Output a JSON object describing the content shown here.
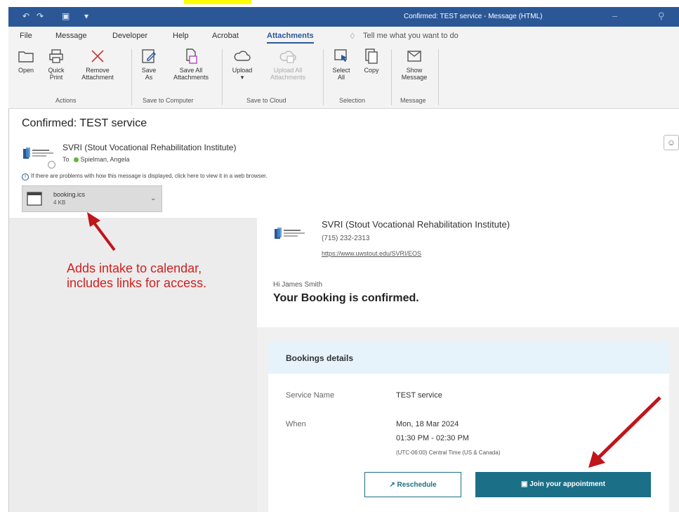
{
  "window": {
    "title": "Confirmed: TEST service  -  Message (HTML)"
  },
  "menu": {
    "items": [
      "File",
      "Message",
      "Developer",
      "Help",
      "Acrobat",
      "Attachments"
    ],
    "tell_me": "Tell me what you want to do"
  },
  "ribbon": {
    "actions": {
      "open": "Open",
      "quick_print_1": "Quick",
      "quick_print_2": "Print",
      "remove_1": "Remove",
      "remove_2": "Attachment",
      "label": "Actions"
    },
    "save_computer": {
      "save_as_1": "Save",
      "save_as_2": "As",
      "save_all_1": "Save All",
      "save_all_2": "Attachments",
      "label": "Save to Computer"
    },
    "save_cloud": {
      "upload": "Upload",
      "upload_all_1": "Upload All",
      "upload_all_2": "Attachments",
      "label": "Save to Cloud"
    },
    "selection": {
      "select_all_1": "Select",
      "select_all_2": "All",
      "copy": "Copy",
      "label": "Selection"
    },
    "message": {
      "show_1": "Show",
      "show_2": "Message",
      "label": "Message"
    }
  },
  "message": {
    "subject": "Confirmed: TEST service",
    "sender": "SVRI (Stout Vocational Rehabilitation Institute)",
    "to_label": "To",
    "recipient": "Spielman, Angela",
    "info_bar": "If there are problems with how this message is displayed, click here to view it in a web browser."
  },
  "attachment": {
    "name": "booking.ics",
    "size": "4 KB"
  },
  "annotation": {
    "line1": "Adds intake to calendar,",
    "line2": "includes links for access."
  },
  "email": {
    "org_name": "SVRI (Stout Vocational Rehabilitation Institute)",
    "phone": "(715) 232-2313",
    "url": "https://www.uwstout.edu/SVRI/EOS",
    "greeting": "Hi James Smith",
    "headline": "Your Booking is confirmed.",
    "details_title": "Bookings details",
    "service_label": "Service Name",
    "service_value": "TEST service",
    "when_label": "When",
    "when_date": "Mon, 18 Mar 2024",
    "when_time": "01:30 PM - 02:30 PM",
    "when_tz": "(UTC-06:00) Central Time (US & Canada)",
    "reschedule": "Reschedule",
    "join": "Join your appointment"
  },
  "colors": {
    "titlebar": "#2b5797",
    "accent": "#1b6f86",
    "annotation": "#d21f1f",
    "highlight": "#ffff00"
  }
}
